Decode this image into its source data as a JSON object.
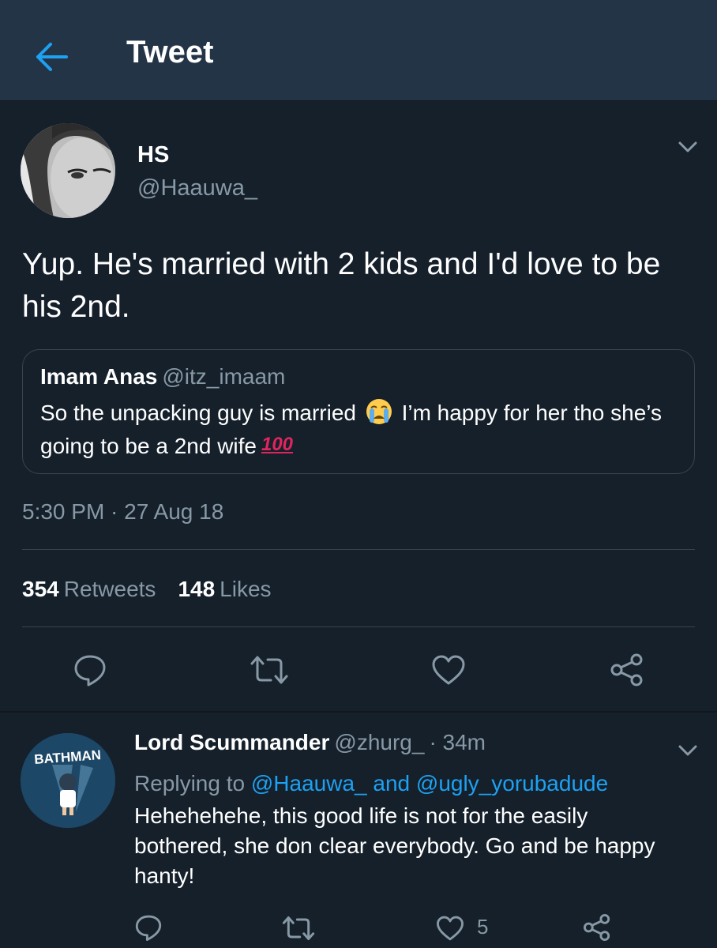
{
  "header": {
    "title": "Tweet"
  },
  "tweet": {
    "display_name": "HS",
    "handle": "@Haauwa_",
    "text": "Yup. He's married with 2 kids and I'd love to be his 2nd.",
    "quote": {
      "name": "Imam Anas",
      "handle": "@itz_imaam",
      "text_part1": "So the unpacking guy is married",
      "text_part2": "I’m happy for her tho she’s going to be a 2nd wife",
      "emoji_100": "100"
    },
    "timestamp": "5:30 PM · 27 Aug 18",
    "retweets_count": "354",
    "retweets_label": "Retweets",
    "likes_count": "148",
    "likes_label": "Likes"
  },
  "reply": {
    "display_name": "Lord Scummander",
    "handle": "@zhurg_",
    "time": "· 34m",
    "replying_prefix": "Replying to",
    "mention1": "@Haauwa_",
    "and_text": "and",
    "mention2": "@ugly_yorubadude",
    "text": "Hehehehehe, this good life is not for the easily bothered, she don clear everybody. Go and be happy hanty!",
    "avatar_text": "BATHMAN",
    "like_count": "5"
  },
  "colors": {
    "background": "#15202b",
    "header": "#243447",
    "accent": "#1da1f2",
    "secondary_text": "#8899a6",
    "border": "#38444d"
  },
  "icons": [
    "back-arrow-icon",
    "chevron-down-icon",
    "reply-icon",
    "retweet-icon",
    "heart-icon",
    "share-icon"
  ]
}
